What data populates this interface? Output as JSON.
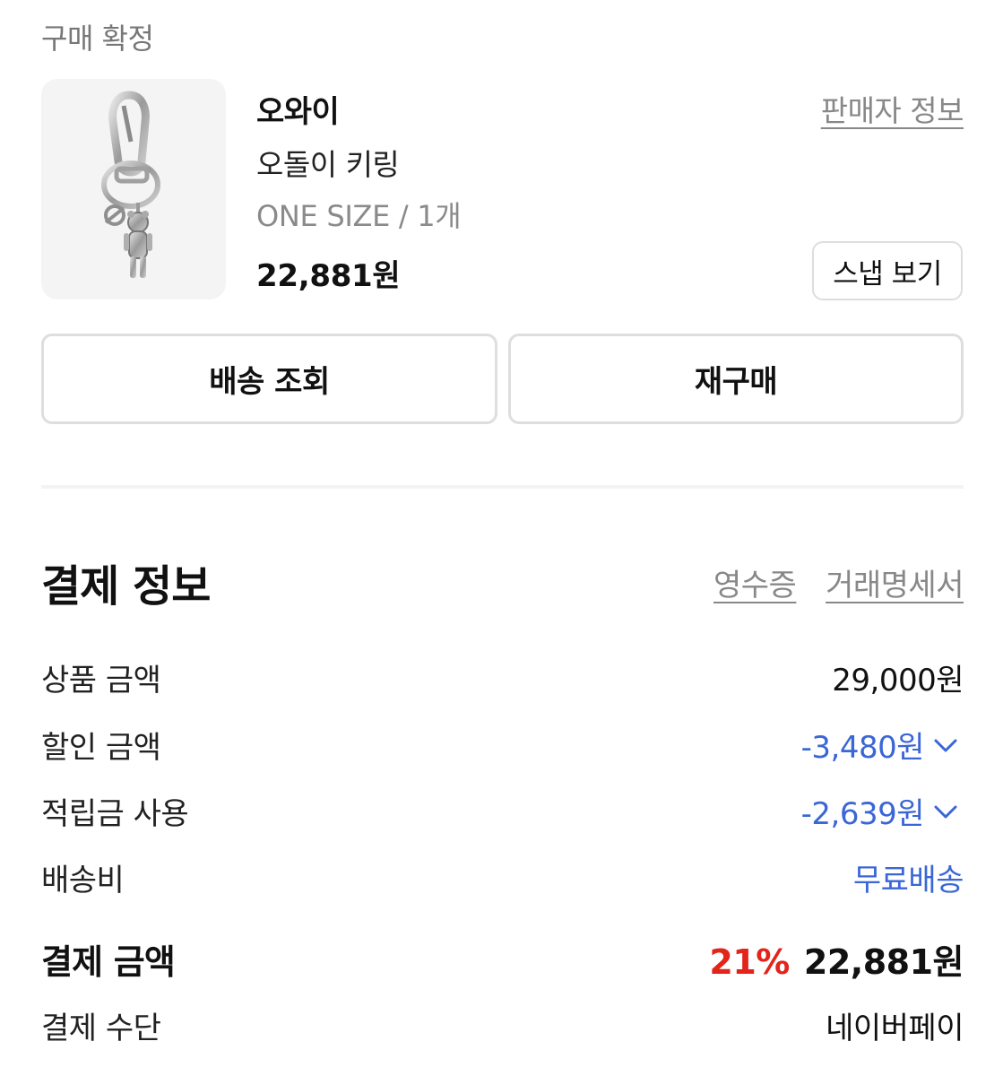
{
  "order_status": "구매 확정",
  "product": {
    "image_alt": "product-keyring-image",
    "brand": "오와이",
    "seller_info_link": "판매자 정보",
    "name": "오돌이 키링",
    "option": "ONE SIZE / 1개",
    "price": "22,881원",
    "snap_button": "스냅 보기"
  },
  "actions": {
    "track_delivery": "배송 조회",
    "rebuy": "재구매"
  },
  "payment": {
    "title": "결제 정보",
    "receipt_link": "영수증",
    "statement_link": "거래명세서",
    "rows": [
      {
        "label": "상품 금액",
        "value": "29,000원"
      },
      {
        "label": "할인 금액",
        "value": "-3,480원"
      },
      {
        "label": "적립금 사용",
        "value": "-2,639원"
      },
      {
        "label": "배송비",
        "value": "무료배송"
      }
    ],
    "total_label": "결제 금액",
    "discount_rate": "21%",
    "total_value": "22,881원",
    "method_label": "결제 수단",
    "method_value": "네이버페이"
  },
  "colors": {
    "accent_blue": "#3a66d6",
    "discount_red": "#e2241b",
    "muted_gray": "#888888"
  }
}
